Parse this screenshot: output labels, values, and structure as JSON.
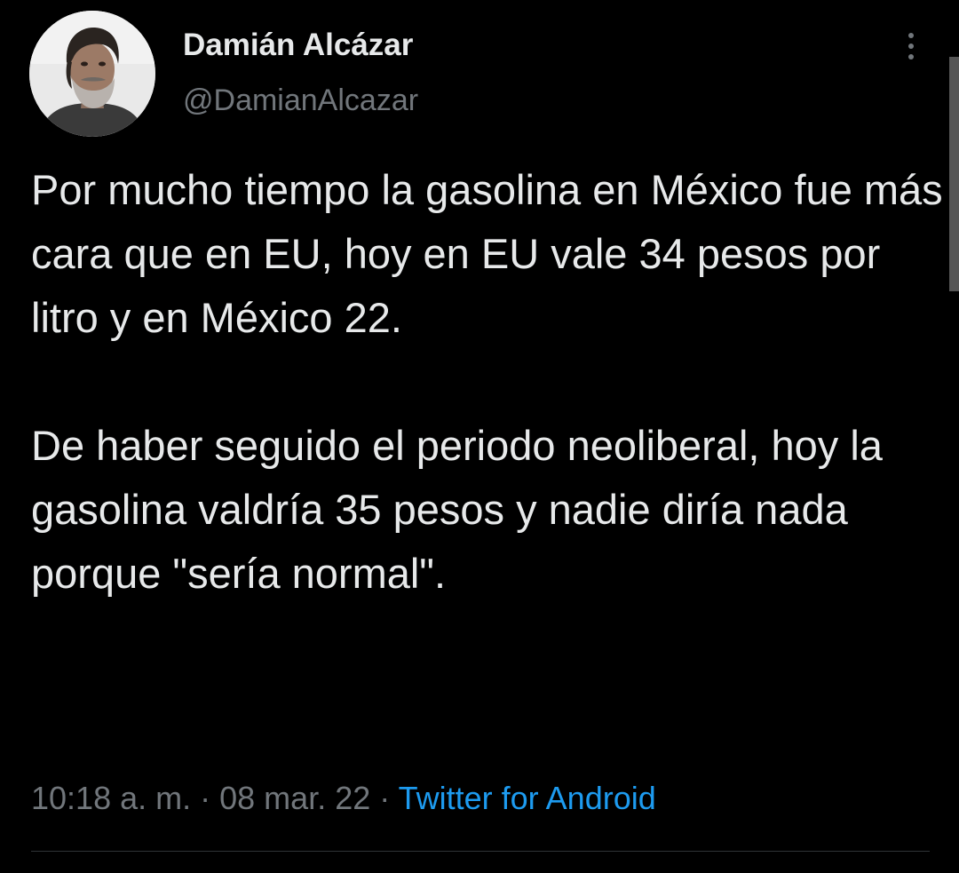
{
  "tweet": {
    "author": {
      "display_name": "Damián Alcázar",
      "handle": "@DamianAlcazar",
      "avatar_icon": "profile-photo"
    },
    "more_icon": "more-vertical-icon",
    "text": "Por mucho tiempo la gasolina en México fue más cara que en EU, hoy en EU vale 34 pesos por litro y en México 22.\n\nDe haber seguido el periodo neoliberal, hoy la gasolina valdría 35 pesos y nadie diría nada porque \"sería normal\".",
    "time": "10:18 a. m.",
    "separator": "·",
    "date": "08 mar. 22",
    "source": "Twitter for Android"
  },
  "colors": {
    "background": "#000000",
    "text": "#e7e9ea",
    "secondary": "#71767b",
    "link": "#1d9bf0",
    "divider": "#2f3336"
  }
}
